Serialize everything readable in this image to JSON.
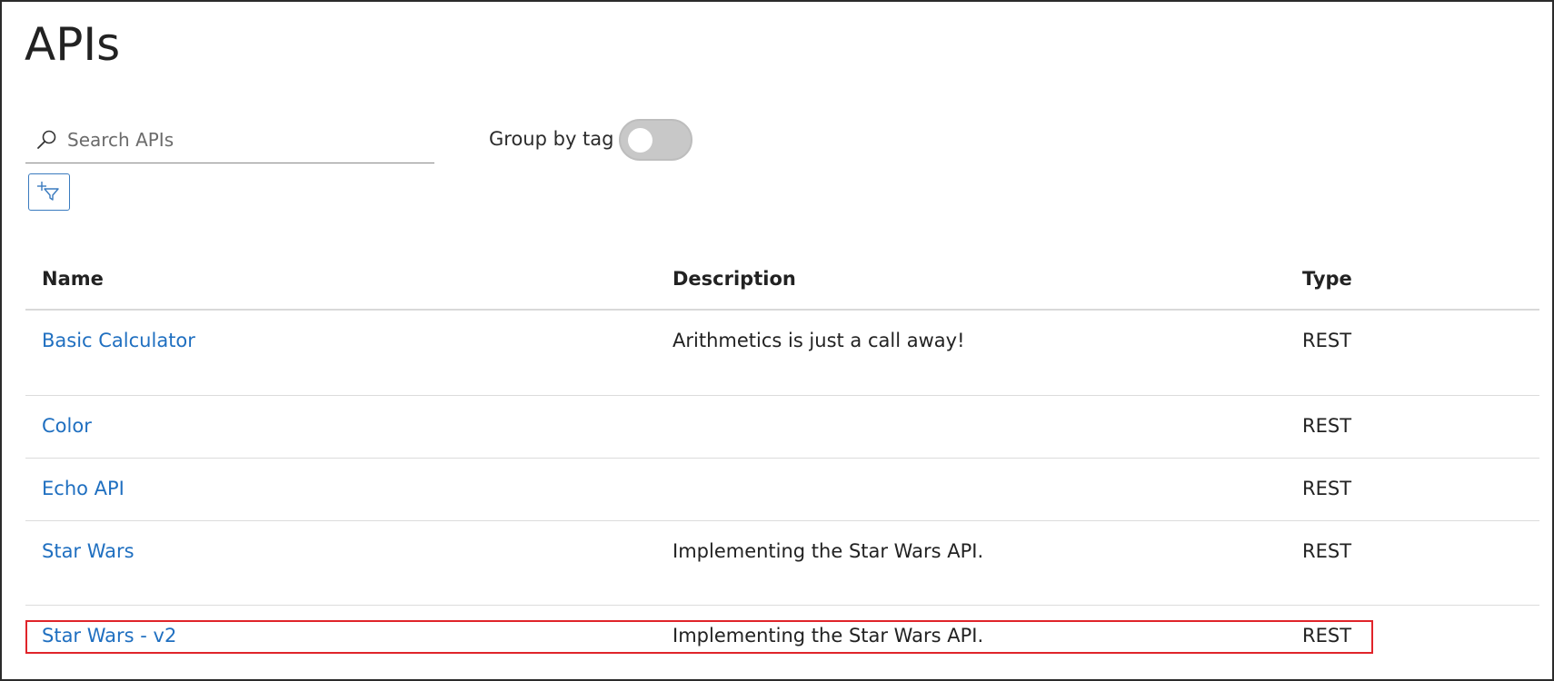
{
  "page": {
    "title": "APIs"
  },
  "search": {
    "placeholder": "Search APIs",
    "value": ""
  },
  "group_toggle": {
    "label": "Group by tag",
    "enabled": false
  },
  "table": {
    "columns": [
      "Name",
      "Description",
      "Type"
    ],
    "rows": [
      {
        "name": "Basic Calculator",
        "description": "Arithmetics is just a call away!",
        "type": "REST"
      },
      {
        "name": "Color",
        "description": "",
        "type": "REST"
      },
      {
        "name": "Echo API",
        "description": "",
        "type": "REST"
      },
      {
        "name": "Star Wars",
        "description": "Implementing the Star Wars API.",
        "type": "REST"
      },
      {
        "name": "Star Wars - v2",
        "description": "Implementing the Star Wars API.",
        "type": "REST"
      }
    ]
  },
  "icons": {
    "search": "search-icon",
    "filter": "add-filter-icon"
  },
  "colors": {
    "link": "#1f6fc0",
    "accent": "#3a7bbf",
    "highlight": "#e0242a",
    "toggle_off": "#c8c8c8"
  }
}
